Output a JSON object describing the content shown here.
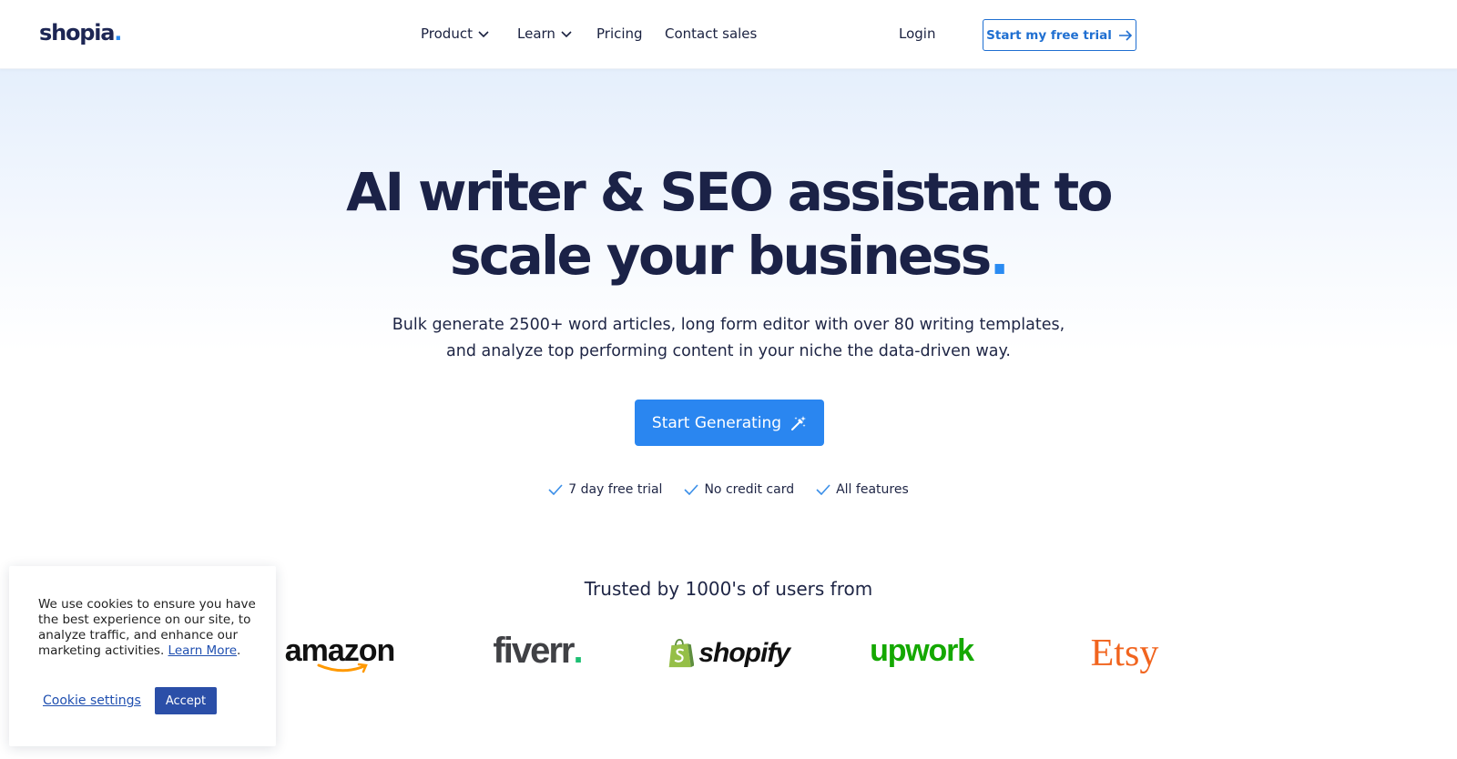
{
  "header": {
    "logo_text": "shopia",
    "logo_dot": ".",
    "nav": {
      "product": "Product",
      "learn": "Learn",
      "pricing": "Pricing",
      "contact": "Contact sales"
    },
    "login": "Login",
    "trial_button": "Start my free trial"
  },
  "hero": {
    "title_line1": "AI writer & SEO assistant to",
    "title_line2": "scale your business",
    "title_dot": ".",
    "subtitle_line1": "Bulk generate 2500+ word articles, long form editor with over 80 writing templates,",
    "subtitle_line2": "and analyze top performing content in your niche the data-driven way.",
    "cta": "Start Generating",
    "checks": [
      "7 day free trial",
      "No credit card",
      "All features"
    ]
  },
  "trusted": {
    "heading": "Trusted by 1000's of users from",
    "brands": {
      "amazon": "amazon",
      "fiverr": "fiverr",
      "fiverr_dot": ".",
      "shopify": "shopify",
      "upwork": "upwork",
      "etsy": "Etsy"
    }
  },
  "cookie": {
    "text": "We use cookies to ensure you have the best experience on our site, to analyze traffic, and enhance our marketing activities.",
    "learn_more": "Learn More",
    "period": ".",
    "settings": "Cookie settings",
    "accept": "Accept"
  },
  "colors": {
    "accent": "#2a86f0",
    "navy": "#1b2247",
    "link": "#1f4fb0"
  }
}
